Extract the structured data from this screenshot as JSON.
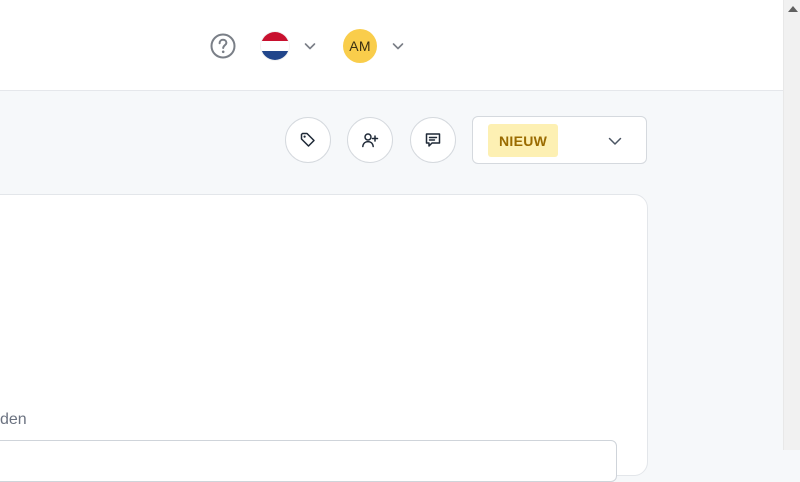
{
  "header": {
    "help_icon": "question-circle-icon",
    "language": {
      "flag": "netherlands-flag",
      "colors": [
        "#c8102e",
        "#ffffff",
        "#21468b"
      ]
    },
    "user": {
      "initials": "AM",
      "avatar_color": "#f9cd4b"
    }
  },
  "toolbar": {
    "buttons": [
      {
        "icon": "tag-icon"
      },
      {
        "icon": "user-plus-icon"
      },
      {
        "icon": "comment-icon"
      }
    ],
    "status": {
      "label": "NIEUW",
      "badge_bg": "#fdf0b3",
      "badge_color": "#9a6b00"
    }
  },
  "form": {
    "field_label_partial": "den"
  }
}
